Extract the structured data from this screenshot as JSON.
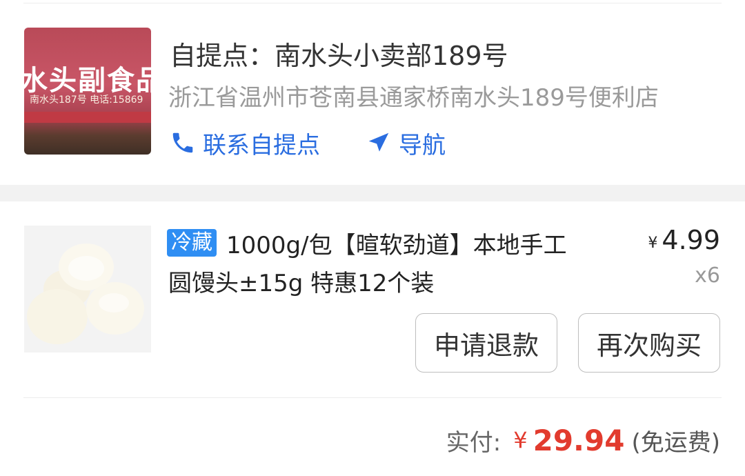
{
  "pickup": {
    "title": "自提点：南水头小卖部189号",
    "address": "浙江省温州市苍南县通家桥南水头189号便利店",
    "photo_sign": "水头副食品",
    "photo_subtext": "南水头187号  电话:15869",
    "contact_label": "联系自提点",
    "navigate_label": "导航"
  },
  "order_item": {
    "tag": "冷藏",
    "name_line1": "1000g/包【暄软劲道】本地手工",
    "name_line2": "圆馒头±15g 特惠12个装",
    "currency": "¥",
    "price": "4.99",
    "quantity": "x6"
  },
  "actions": {
    "refund_label": "申请退款",
    "rebuy_label": "再次购买"
  },
  "summary": {
    "paid_label": "实付:",
    "currency": "¥",
    "amount": "29.94",
    "shipping_note": "(免运费)"
  },
  "colors": {
    "accent_blue": "#2a6de0",
    "tag_blue": "#2f8ef3",
    "price_red": "#e23b2e"
  },
  "icons": {
    "contact": "phone-icon",
    "navigate": "navigation-arrow-icon"
  }
}
